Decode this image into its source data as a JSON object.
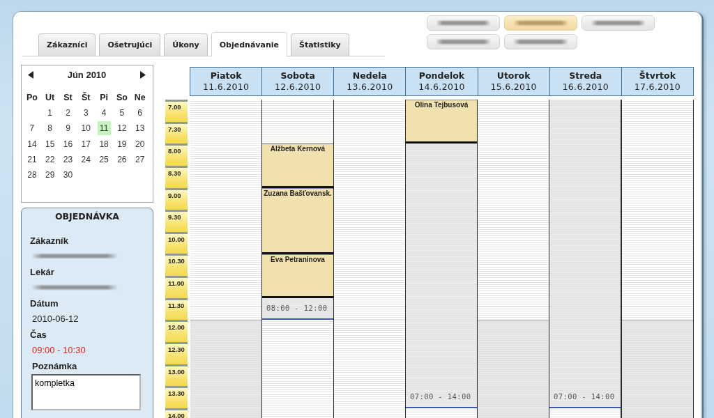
{
  "tabs": [
    {
      "label": "Zákazníci",
      "selected": false
    },
    {
      "label": "Ošetrujúci",
      "selected": false
    },
    {
      "label": "Úkony",
      "selected": false
    },
    {
      "label": "Objednávanie",
      "selected": true
    },
    {
      "label": "Štatistiky",
      "selected": false
    }
  ],
  "doctor_buttons": [
    {
      "selected": false
    },
    {
      "selected": true
    },
    {
      "selected": false
    },
    {
      "selected": false
    },
    {
      "selected": false
    }
  ],
  "calendar": {
    "month": "Jún 2010",
    "weekdays": [
      "Po",
      "Ut",
      "St",
      "Št",
      "Pi",
      "So",
      "Ne"
    ],
    "weeks": [
      {
        "align_end": true,
        "days": [
          {
            "label": "1",
            "selected": false
          },
          {
            "label": "2",
            "selected": false
          },
          {
            "label": "3",
            "selected": false
          },
          {
            "label": "4",
            "selected": false
          },
          {
            "label": "5",
            "selected": false
          },
          {
            "label": "6",
            "selected": false
          }
        ]
      },
      {
        "days": [
          {
            "label": "7",
            "selected": false
          },
          {
            "label": "8",
            "selected": false
          },
          {
            "label": "9",
            "selected": false
          },
          {
            "label": "10",
            "selected": false
          },
          {
            "label": "11",
            "selected": true
          },
          {
            "label": "12",
            "selected": false
          },
          {
            "label": "13",
            "selected": false
          }
        ]
      },
      {
        "days": [
          {
            "label": "14",
            "selected": false
          },
          {
            "label": "15",
            "selected": false
          },
          {
            "label": "16",
            "selected": false
          },
          {
            "label": "17",
            "selected": false
          },
          {
            "label": "18",
            "selected": false
          },
          {
            "label": "19",
            "selected": false
          },
          {
            "label": "20",
            "selected": false
          }
        ]
      },
      {
        "days": [
          {
            "label": "21",
            "selected": false
          },
          {
            "label": "22",
            "selected": false
          },
          {
            "label": "23",
            "selected": false
          },
          {
            "label": "24",
            "selected": false
          },
          {
            "label": "25",
            "selected": false
          },
          {
            "label": "26",
            "selected": false
          },
          {
            "label": "27",
            "selected": false
          }
        ]
      },
      {
        "align_end": false,
        "days": [
          {
            "label": "28",
            "selected": false
          },
          {
            "label": "29",
            "selected": false
          },
          {
            "label": "30",
            "selected": false
          }
        ]
      }
    ]
  },
  "order": {
    "title": "OBJEDNÁVKA",
    "fields": [
      {
        "label": "Zákazník",
        "kind": "blurred"
      },
      {
        "label": "Lekár",
        "kind": "blurred"
      },
      {
        "label": "Dátum",
        "kind": "text",
        "value": "2010-06-12"
      },
      {
        "label": "Čas",
        "kind": "alert",
        "value": "09:00 - 10:30"
      }
    ],
    "note": {
      "label": "Poznámka",
      "value": "kompletka"
    }
  },
  "schedule": {
    "times": [
      "7.00",
      "7.30",
      "8.00",
      "8.30",
      "9.00",
      "9.30",
      "10.00",
      "10.30",
      "11.00",
      "11.30",
      "12.00",
      "12.30",
      "13.00",
      "13.30",
      "14.00"
    ],
    "days": [
      {
        "name": "Piatok",
        "date": "11.6.2010",
        "bordered": false,
        "slots": [
          {
            "kind": "free"
          },
          {
            "kind": "free"
          },
          {
            "kind": "free"
          },
          {
            "kind": "free"
          },
          {
            "kind": "free"
          },
          {
            "kind": "free"
          },
          {
            "kind": "free"
          },
          {
            "kind": "free"
          },
          {
            "kind": "free"
          },
          {
            "kind": "free"
          },
          {
            "kind": "closed"
          },
          {
            "kind": "closed"
          },
          {
            "kind": "closed"
          },
          {
            "kind": "closed"
          },
          {
            "kind": "closed"
          }
        ]
      },
      {
        "name": "Sobota",
        "date": "12.6.2010",
        "bordered": true,
        "slots": [
          {
            "kind": "free"
          },
          {
            "kind": "free"
          },
          {
            "kind": "appointment",
            "label": "Alžbeta Kernová"
          },
          {
            "kind": "appointment"
          },
          {
            "kind": "appointment",
            "label": "Zuzana Bašťovansk."
          },
          {
            "kind": "appointment"
          },
          {
            "kind": "appointment"
          },
          {
            "kind": "appointment",
            "label": "Eva Petraninova"
          },
          {
            "kind": "appointment"
          },
          {
            "kind": "shift",
            "label": "08:00 - 12:00"
          },
          {
            "kind": "free"
          },
          {
            "kind": "free"
          },
          {
            "kind": "free"
          },
          {
            "kind": "free"
          },
          {
            "kind": "free"
          }
        ]
      },
      {
        "name": "Nedela",
        "date": "13.6.2010",
        "bordered": false,
        "slots": [
          {
            "kind": "free"
          },
          {
            "kind": "free"
          },
          {
            "kind": "free"
          },
          {
            "kind": "free"
          },
          {
            "kind": "free"
          },
          {
            "kind": "free"
          },
          {
            "kind": "free"
          },
          {
            "kind": "free"
          },
          {
            "kind": "free"
          },
          {
            "kind": "free"
          },
          {
            "kind": "free"
          },
          {
            "kind": "free"
          },
          {
            "kind": "free"
          },
          {
            "kind": "free"
          },
          {
            "kind": "free"
          }
        ]
      },
      {
        "name": "Pondelok",
        "date": "14.6.2010",
        "bordered": true,
        "slots": [
          {
            "kind": "appointment",
            "label": "Olina Tejbusová"
          },
          {
            "kind": "appointment"
          },
          {
            "kind": "shift",
            "label": "07:00 - 14:00"
          },
          {
            "kind": "shift"
          },
          {
            "kind": "shift"
          },
          {
            "kind": "shift"
          },
          {
            "kind": "shift"
          },
          {
            "kind": "shift"
          },
          {
            "kind": "shift"
          },
          {
            "kind": "shift"
          },
          {
            "kind": "shift"
          },
          {
            "kind": "shift"
          },
          {
            "kind": "shift"
          },
          {
            "kind": "shift"
          },
          {
            "kind": "free"
          }
        ]
      },
      {
        "name": "Utorok",
        "date": "15.6.2010",
        "bordered": false,
        "slots": [
          {
            "kind": "free"
          },
          {
            "kind": "free"
          },
          {
            "kind": "free"
          },
          {
            "kind": "free"
          },
          {
            "kind": "free"
          },
          {
            "kind": "free"
          },
          {
            "kind": "free"
          },
          {
            "kind": "free"
          },
          {
            "kind": "free"
          },
          {
            "kind": "free"
          },
          {
            "kind": "closed"
          },
          {
            "kind": "closed"
          },
          {
            "kind": "closed"
          },
          {
            "kind": "closed"
          },
          {
            "kind": "closed"
          }
        ]
      },
      {
        "name": "Streda",
        "date": "16.6.2010",
        "bordered": true,
        "slots": [
          {
            "kind": "shift",
            "label": "07:00 - 14:00"
          },
          {
            "kind": "shift"
          },
          {
            "kind": "shift"
          },
          {
            "kind": "shift"
          },
          {
            "kind": "shift"
          },
          {
            "kind": "shift"
          },
          {
            "kind": "shift"
          },
          {
            "kind": "shift"
          },
          {
            "kind": "shift"
          },
          {
            "kind": "shift"
          },
          {
            "kind": "shift"
          },
          {
            "kind": "shift"
          },
          {
            "kind": "shift"
          },
          {
            "kind": "shift"
          },
          {
            "kind": "free"
          }
        ]
      },
      {
        "name": "Štvrtok",
        "date": "17.6.2010",
        "bordered": true,
        "slots": [
          {
            "kind": "free"
          },
          {
            "kind": "free"
          },
          {
            "kind": "free"
          },
          {
            "kind": "free"
          },
          {
            "kind": "free"
          },
          {
            "kind": "free"
          },
          {
            "kind": "free"
          },
          {
            "kind": "free"
          },
          {
            "kind": "free"
          },
          {
            "kind": "free"
          },
          {
            "kind": "closed"
          },
          {
            "kind": "closed"
          },
          {
            "kind": "closed"
          },
          {
            "kind": "closed"
          },
          {
            "kind": "closed"
          }
        ]
      }
    ]
  }
}
